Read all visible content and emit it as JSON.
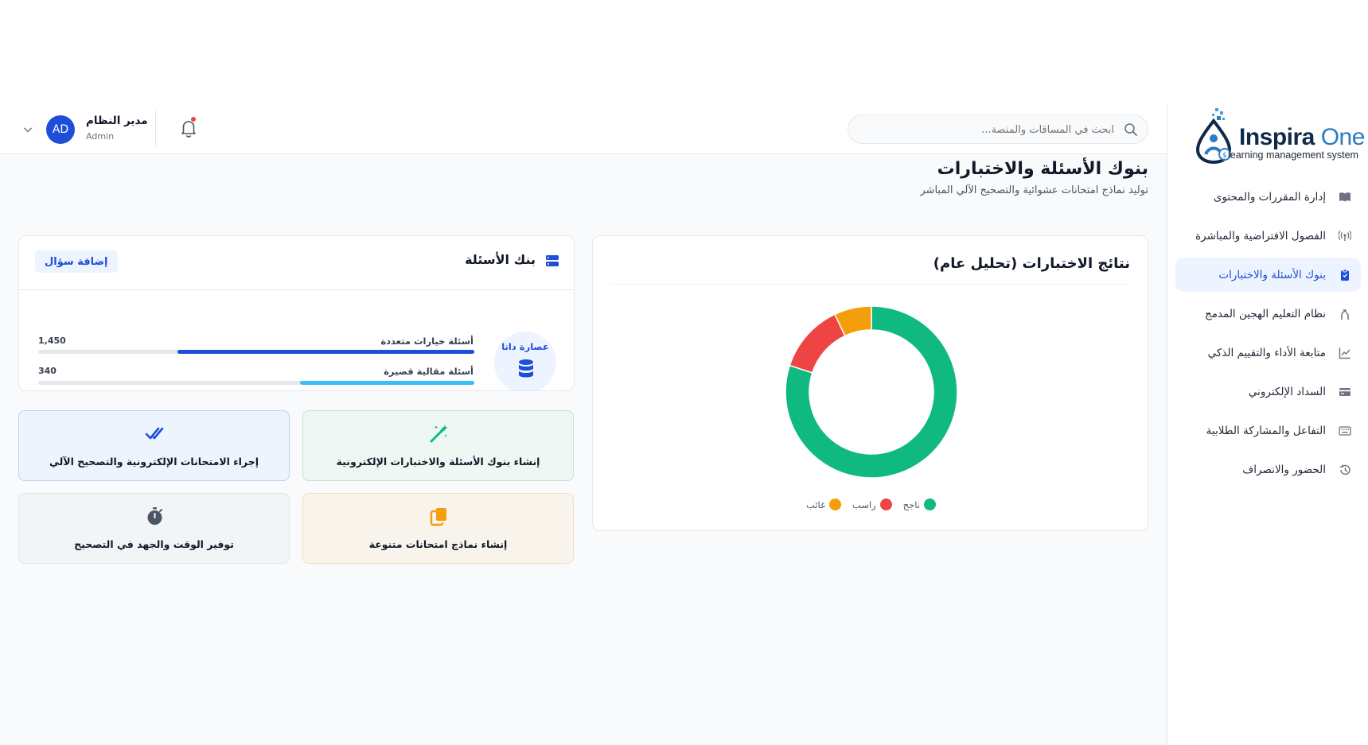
{
  "brand": {
    "name_main": "Inspira",
    "name_accent": "One",
    "tagline": "learning management system"
  },
  "sidebar": {
    "items": [
      {
        "label": "إدارة المقررات والمحتوى",
        "icon": "book-icon",
        "active": false
      },
      {
        "label": "الفصول الافتراضية والمباشرة",
        "icon": "broadcast-icon",
        "active": false
      },
      {
        "label": "بنوك الأسئلة والاختبارات",
        "icon": "clipboard-icon",
        "active": true
      },
      {
        "label": "نظام التعليم الهجين المدمج",
        "icon": "merge-icon",
        "active": false
      },
      {
        "label": "متابعة الأداء والتقييم الذكي",
        "icon": "chart-line-icon",
        "active": false
      },
      {
        "label": "السداد الإلكتروني",
        "icon": "credit-card-icon",
        "active": false
      },
      {
        "label": "التفاعل والمشاركة الطلابية",
        "icon": "keyboard-icon",
        "active": false
      },
      {
        "label": "الحضور والانصراف",
        "icon": "history-icon",
        "active": false
      }
    ]
  },
  "header": {
    "search_placeholder": "ابحث في المساقات والمنصة...",
    "user_name": "مدير النظام",
    "user_role": "Admin",
    "avatar_initials": "AD"
  },
  "page": {
    "title": "بنوك الأسئلة والاختبارات",
    "subtitle": "توليد نماذج امتحانات عشوائية والتصحيح الآلي المباشر"
  },
  "results": {
    "title": "نتائج الاختبارات (تحليل عام)"
  },
  "chart_data": {
    "type": "pie",
    "categories": [
      "ناجح",
      "راسب",
      "غائب"
    ],
    "values": [
      80,
      13,
      7
    ],
    "colors": [
      "#10b981",
      "#ef4444",
      "#f59e0b"
    ],
    "legend": "bottom"
  },
  "bank": {
    "title": "بنك الأسئلة",
    "add_button": "إضافة سؤال",
    "data_label": "عصارة داتا",
    "stats": [
      {
        "label": "أسئلة خيارات متعددة",
        "value": "1,450",
        "fill": 0.68,
        "color": "#1d4ed8"
      },
      {
        "label": "أسئلة مقالية قصيرة",
        "value": "340",
        "fill": 0.4,
        "color": "#38bdf8"
      }
    ]
  },
  "features": [
    {
      "label": "إنشاء بنوك الأسئلة والاختبارات الإلكترونية",
      "icon": "magic-wand-icon",
      "color": "#10b981"
    },
    {
      "label": "إجراء الامتحانات الإلكترونية والتصحيح الآلي",
      "icon": "double-check-icon",
      "color": "#1d4ed8"
    },
    {
      "label": "إنشاء نماذج امتحانات متنوعة",
      "icon": "copy-icon",
      "color": "#f59e0b"
    },
    {
      "label": "توفير الوقت والجهد في التصحيح",
      "icon": "stopwatch-icon",
      "color": "#4b5563"
    }
  ]
}
